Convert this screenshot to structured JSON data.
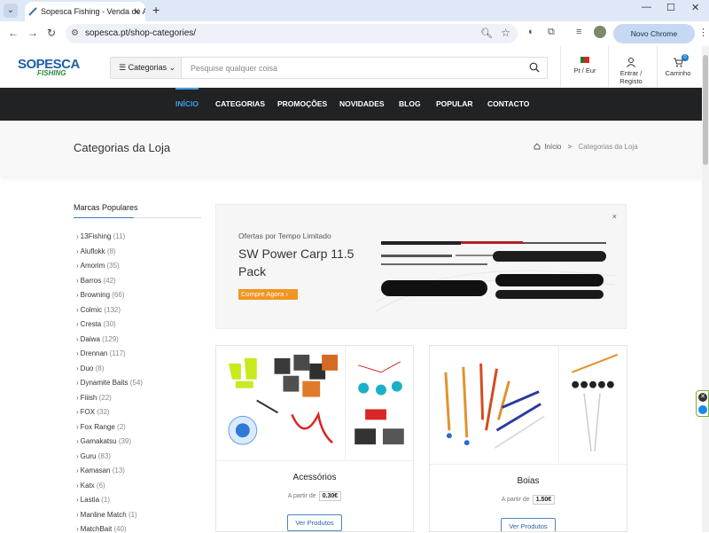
{
  "browser": {
    "tab_title": "Sopesca Fishing - Venda de Art",
    "url": "sopesca.pt/shop-categories/",
    "update_label": "Novo Chrome disponível"
  },
  "header": {
    "logo_top": "SOPESCA",
    "logo_bottom": "FISHING",
    "categories_label": "Categorias",
    "search_placeholder": "Pesquise qualquer coisa",
    "lang_label": "Pt / Eur",
    "account_label": "Entrar / Registo",
    "cart_label": "Carrinho",
    "cart_count": "0"
  },
  "nav": [
    "INÍCIO",
    "CATEGORIAS",
    "PROMOÇÕES",
    "NOVIDADES",
    "BLOG",
    "POPULAR",
    "CONTACTO"
  ],
  "page": {
    "title": "Categorias da Loja",
    "breadcrumb_home": "Início",
    "breadcrumb_sep": ">",
    "breadcrumb_current": "Categorias da Loja"
  },
  "sidebar": {
    "title": "Marcas Populares",
    "brands": [
      {
        "name": "13Fishing",
        "count": "(11)"
      },
      {
        "name": "Aluflokk",
        "count": "(8)"
      },
      {
        "name": "Amorim",
        "count": "(35)"
      },
      {
        "name": "Barros",
        "count": "(42)"
      },
      {
        "name": "Browning",
        "count": "(66)"
      },
      {
        "name": "Colmic",
        "count": "(132)"
      },
      {
        "name": "Cresta",
        "count": "(30)"
      },
      {
        "name": "Daiwa",
        "count": "(129)"
      },
      {
        "name": "Drennan",
        "count": "(117)"
      },
      {
        "name": "Duo",
        "count": "(8)"
      },
      {
        "name": "Dynamite Baits",
        "count": "(54)"
      },
      {
        "name": "Fiiish",
        "count": "(22)"
      },
      {
        "name": "FOX",
        "count": "(32)"
      },
      {
        "name": "Fox Range",
        "count": "(2)"
      },
      {
        "name": "Gamakatsu",
        "count": "(39)"
      },
      {
        "name": "Guru",
        "count": "(83)"
      },
      {
        "name": "Kamasan",
        "count": "(13)"
      },
      {
        "name": "Katx",
        "count": "(6)"
      },
      {
        "name": "Lastia",
        "count": "(1)"
      },
      {
        "name": "Manline Match",
        "count": "(1)"
      },
      {
        "name": "MatchBait",
        "count": "(40)"
      }
    ]
  },
  "banner": {
    "kicker": "Ofertas por Tempo Limitado",
    "title": "SW Power Carp 11.5 Pack",
    "cta": "Compre Agora",
    "close": "×"
  },
  "cards": [
    {
      "name": "Acessórios",
      "price_prefix": "A partir de",
      "price": "0.30€",
      "button": "Ver Produtos"
    },
    {
      "name": "Boias",
      "price_prefix": "A partir de",
      "price": "1.50€",
      "button": "Ver Produtos"
    }
  ]
}
